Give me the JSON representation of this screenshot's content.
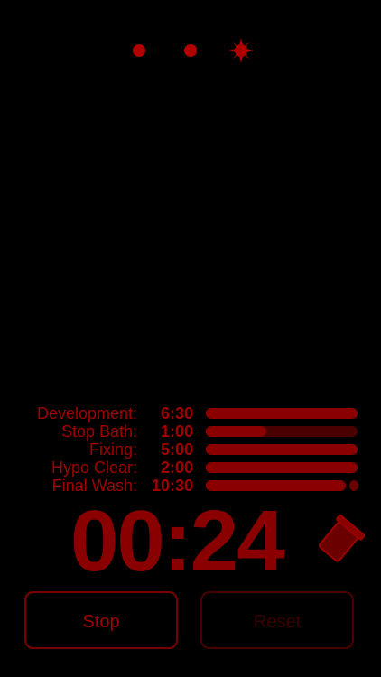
{
  "header": {
    "pages": [
      "page-1",
      "page-2",
      "page-3"
    ],
    "active_page_icon": "sun-icon"
  },
  "steps": [
    {
      "label": "Development:",
      "time": "6:30",
      "progress": 1.0
    },
    {
      "label": "Stop Bath:",
      "time": "1:00",
      "progress": 0.4
    },
    {
      "label": "Fixing:",
      "time": "5:00",
      "progress": 1.0
    },
    {
      "label": "Hypo Clear:",
      "time": "2:00",
      "progress": 1.0
    },
    {
      "label": "Final Wash:",
      "time": "10:30",
      "progress": 1.0
    }
  ],
  "timer": {
    "value": "00:24"
  },
  "buttons": {
    "stop_label": "Stop",
    "reset_label": "Reset"
  },
  "colors": {
    "accent": "#a00000",
    "bar_bg": "#4a0000",
    "bar_fill": "#8a0000"
  }
}
